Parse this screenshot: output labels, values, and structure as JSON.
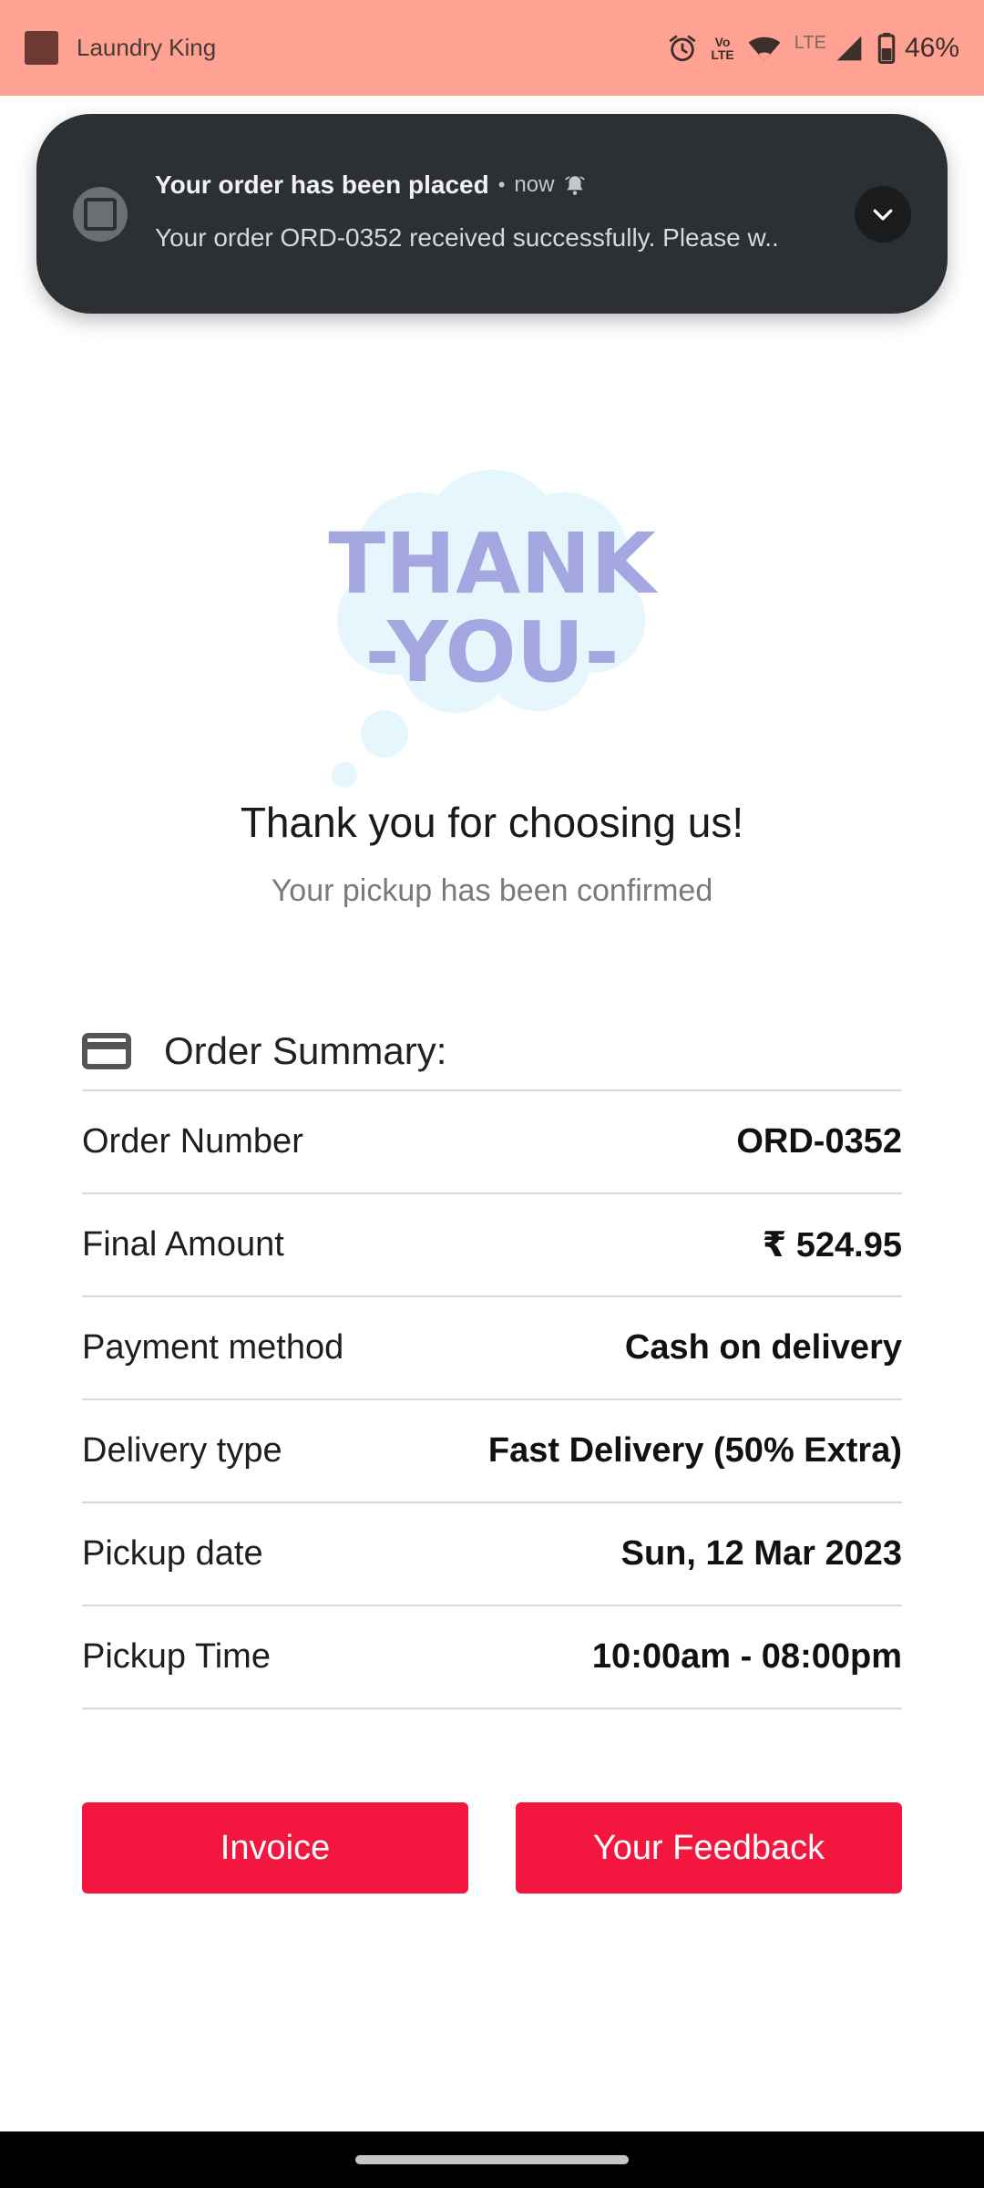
{
  "status_bar": {
    "app_name": "Laundry King",
    "volte_top": "Vo",
    "volte_bottom": "LTE",
    "lte_label": "LTE",
    "battery": "46%"
  },
  "notification": {
    "title": "Your order has been placed",
    "separator": "•",
    "time": "now",
    "body": "Your order ORD-0352 received successfully. Please w.."
  },
  "illustration": {
    "line1": "THANK",
    "line2": "-YOU-"
  },
  "confirmation": {
    "headline": "Thank you for choosing us!",
    "subhead": "Your pickup has been confirmed"
  },
  "summary": {
    "title": "Order Summary:",
    "rows": [
      {
        "label": "Order Number",
        "value": "ORD-0352"
      },
      {
        "label": "Final Amount",
        "value": "₹ 524.95"
      },
      {
        "label": "Payment method",
        "value": "Cash on delivery"
      },
      {
        "label": "Delivery type",
        "value": "Fast Delivery (50% Extra)"
      },
      {
        "label": "Pickup date",
        "value": "Sun, 12 Mar 2023"
      },
      {
        "label": "Pickup Time",
        "value": "10:00am - 08:00pm"
      }
    ]
  },
  "actions": {
    "invoice": "Invoice",
    "feedback": "Your Feedback"
  },
  "colors": {
    "status_bar": "#ffa293",
    "notification_bg": "#2c2f33",
    "primary_button": "#f3163f",
    "thank_you_text": "#a4a7e0",
    "cloud": "#e6f6fd"
  }
}
